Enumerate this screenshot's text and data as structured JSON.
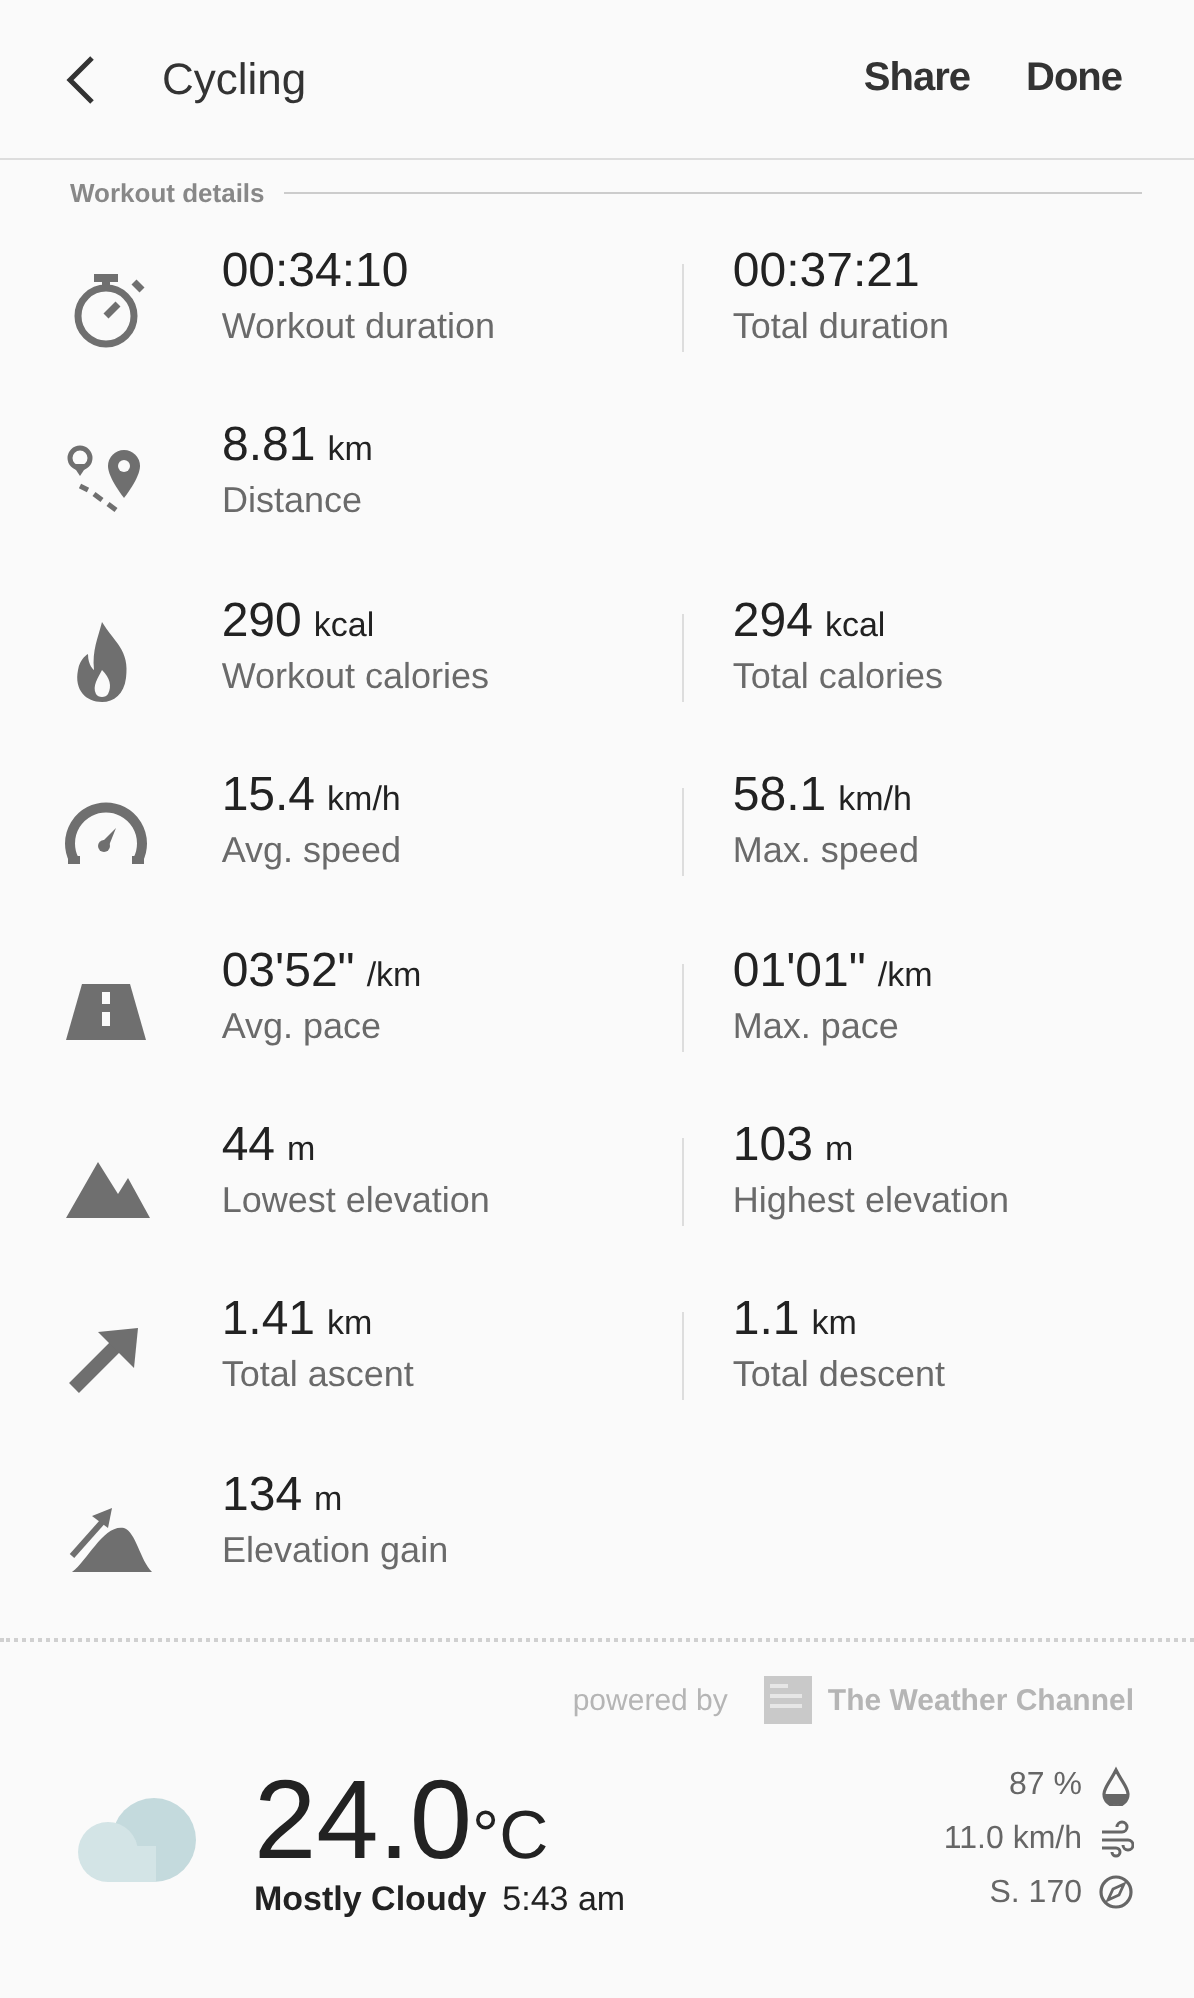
{
  "header": {
    "title": "Cycling",
    "actions": [
      "Share",
      "Done"
    ]
  },
  "section": {
    "title": "Workout details"
  },
  "rows": [
    {
      "kind": "stopwatch",
      "cells": [
        {
          "value": "00:34:10",
          "label": "Workout duration"
        },
        {
          "value": "00:37:21",
          "label": "Total duration"
        }
      ]
    },
    {
      "kind": "route",
      "cells": [
        {
          "value": "8.81",
          "unit": "km",
          "label": "Distance"
        }
      ]
    },
    {
      "kind": "flame",
      "cells": [
        {
          "value": "290",
          "unit": "kcal",
          "label": "Workout calories"
        },
        {
          "value": "294",
          "unit": "kcal",
          "label": "Total calories"
        }
      ]
    },
    {
      "kind": "speedometer",
      "cells": [
        {
          "value": "15.4",
          "unit": "km/h",
          "label": "Avg. speed"
        },
        {
          "value": "58.1",
          "unit": "km/h",
          "label": "Max. speed"
        }
      ]
    },
    {
      "kind": "road",
      "cells": [
        {
          "value": "03'52\"",
          "unit": "/km",
          "label": "Avg. pace"
        },
        {
          "value": "01'01\"",
          "unit": "/km",
          "label": "Max. pace"
        }
      ]
    },
    {
      "kind": "mountain",
      "cells": [
        {
          "value": "44",
          "unit": "m",
          "label": "Lowest elevation"
        },
        {
          "value": "103",
          "unit": "m",
          "label": "Highest elevation"
        }
      ]
    },
    {
      "kind": "ascent",
      "cells": [
        {
          "value": "1.41",
          "unit": "km",
          "label": "Total ascent"
        },
        {
          "value": "1.1",
          "unit": "km",
          "label": "Total descent"
        }
      ]
    },
    {
      "kind": "gain",
      "cells": [
        {
          "value": "134",
          "unit": "m",
          "label": "Elevation gain"
        }
      ]
    }
  ],
  "weather": {
    "powered_by": "powered by",
    "provider": "The Weather Channel",
    "temperature": "24.0",
    "temperature_unit": "°C",
    "condition": "Mostly Cloudy",
    "time": "5:43 am",
    "details": [
      {
        "kind": "humidity",
        "text": "87 %"
      },
      {
        "kind": "wind",
        "text": "11.0 km/h"
      },
      {
        "kind": "direction",
        "text": "S. 170"
      }
    ]
  }
}
